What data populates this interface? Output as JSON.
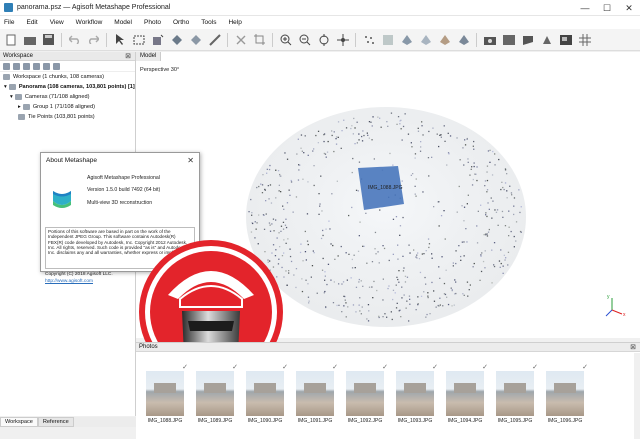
{
  "window": {
    "title": "panorama.psz — Agisoft Metashape Professional",
    "minimize": "—",
    "maximize": "☐",
    "close": "✕"
  },
  "menu": [
    "File",
    "Edit",
    "View",
    "Workflow",
    "Model",
    "Photo",
    "Ortho",
    "Tools",
    "Help"
  ],
  "workspace": {
    "header": "Workspace",
    "root": "Workspace (1 chunks, 108 cameras)",
    "chunk": "Panorama (108 cameras, 103,801 points) [1]",
    "cameras": "Cameras (71/108 aligned)",
    "group": "Group 1 (71/108 aligned)",
    "tie_points": "Tie Points (103,801 points)"
  },
  "bottom_tabs": [
    "Workspace",
    "Reference"
  ],
  "model": {
    "tab": "Model",
    "projection": "Perspective 30°",
    "camera_label": "IMG_1088.JPG",
    "axis_y": "y",
    "axis_x": "x"
  },
  "about": {
    "title": "About Metashape",
    "product": "Agisoft Metashape Professional",
    "version": "Version 1.5.0 build 7492 (64 bit)",
    "subtitle": "Multi-view 3D reconstruction",
    "notice": "Portions of this software are based in part on the work of the Independent JPEG Group. This software contains Autodesk(R) FBX(R) code developed by Autodesk, Inc. Copyright 2012 Autodesk, Inc. All rights, reserved. Such code is provided \"as is\" and Autodesk, Inc. disclaims any and all warranties, whether express or implied",
    "copyright": "Copyright (C) 2018 Agisoft LLC.",
    "link": "http://www.agisoft.com"
  },
  "photos": {
    "header": "Photos",
    "items": [
      "IMG_1088.JPG",
      "IMG_1089.JPG",
      "IMG_1090.JPG",
      "IMG_1091.JPG",
      "IMG_1092.JPG",
      "IMG_1093.JPG",
      "IMG_1094.JPG",
      "IMG_1095.JPG",
      "IMG_1096.JPG"
    ]
  },
  "colors": {
    "accent": "#2f7fb6",
    "overlay_red": "#e3242b",
    "selection_blue": "#3e6fb8"
  },
  "icons": {
    "overlay_logo": "helmet-person-logo"
  }
}
